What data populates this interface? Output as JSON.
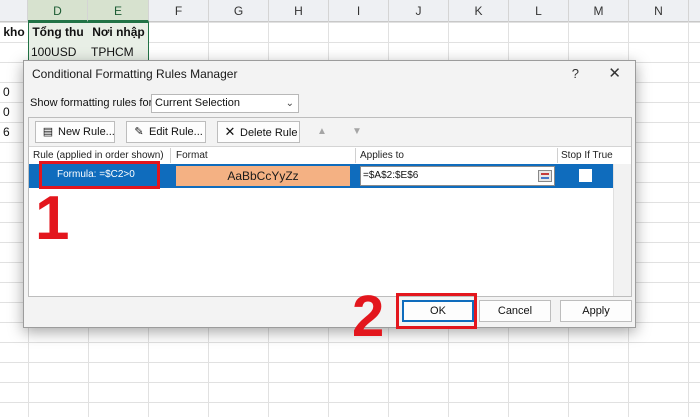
{
  "spreadsheet": {
    "columns": [
      "D",
      "E",
      "F",
      "G",
      "H",
      "I",
      "J",
      "K",
      "L",
      "M",
      "N"
    ],
    "active_columns": [
      "D",
      "E"
    ],
    "header_row": {
      "c": "kho",
      "d": "Tổng thu",
      "e": "Nơi nhập"
    },
    "data_row": {
      "d": "100USD",
      "e": "TPHCM"
    },
    "left_fragments": [
      "0",
      "0",
      "6"
    ]
  },
  "dialog": {
    "title": "Conditional Formatting Rules Manager",
    "help": "?",
    "close": "✕",
    "show_rules_label": "Show formatting rules for:",
    "show_rules_value": "Current Selection",
    "toolbar": {
      "new_rule": "New Rule...",
      "edit_rule": "Edit Rule...",
      "delete_rule": "Delete Rule",
      "move_up": "▲",
      "move_down": "▼"
    },
    "columns": {
      "rule": "Rule (applied in order shown)",
      "format": "Format",
      "applies_to": "Applies to",
      "stop_if_true": "Stop If True"
    },
    "rule": {
      "name": "Formula: =$C2>0",
      "format_preview": "AaBbCcYyZz",
      "applies_to": "=$A$2:$E$6",
      "stop_if_true": false
    },
    "buttons": {
      "ok": "OK",
      "cancel": "Cancel",
      "apply": "Apply"
    },
    "colors": {
      "selected_row": "#0f6cbd",
      "format_fill": "#f4b183"
    }
  },
  "annotations": {
    "step1": "1",
    "step2": "2",
    "color": "#e3161d"
  }
}
